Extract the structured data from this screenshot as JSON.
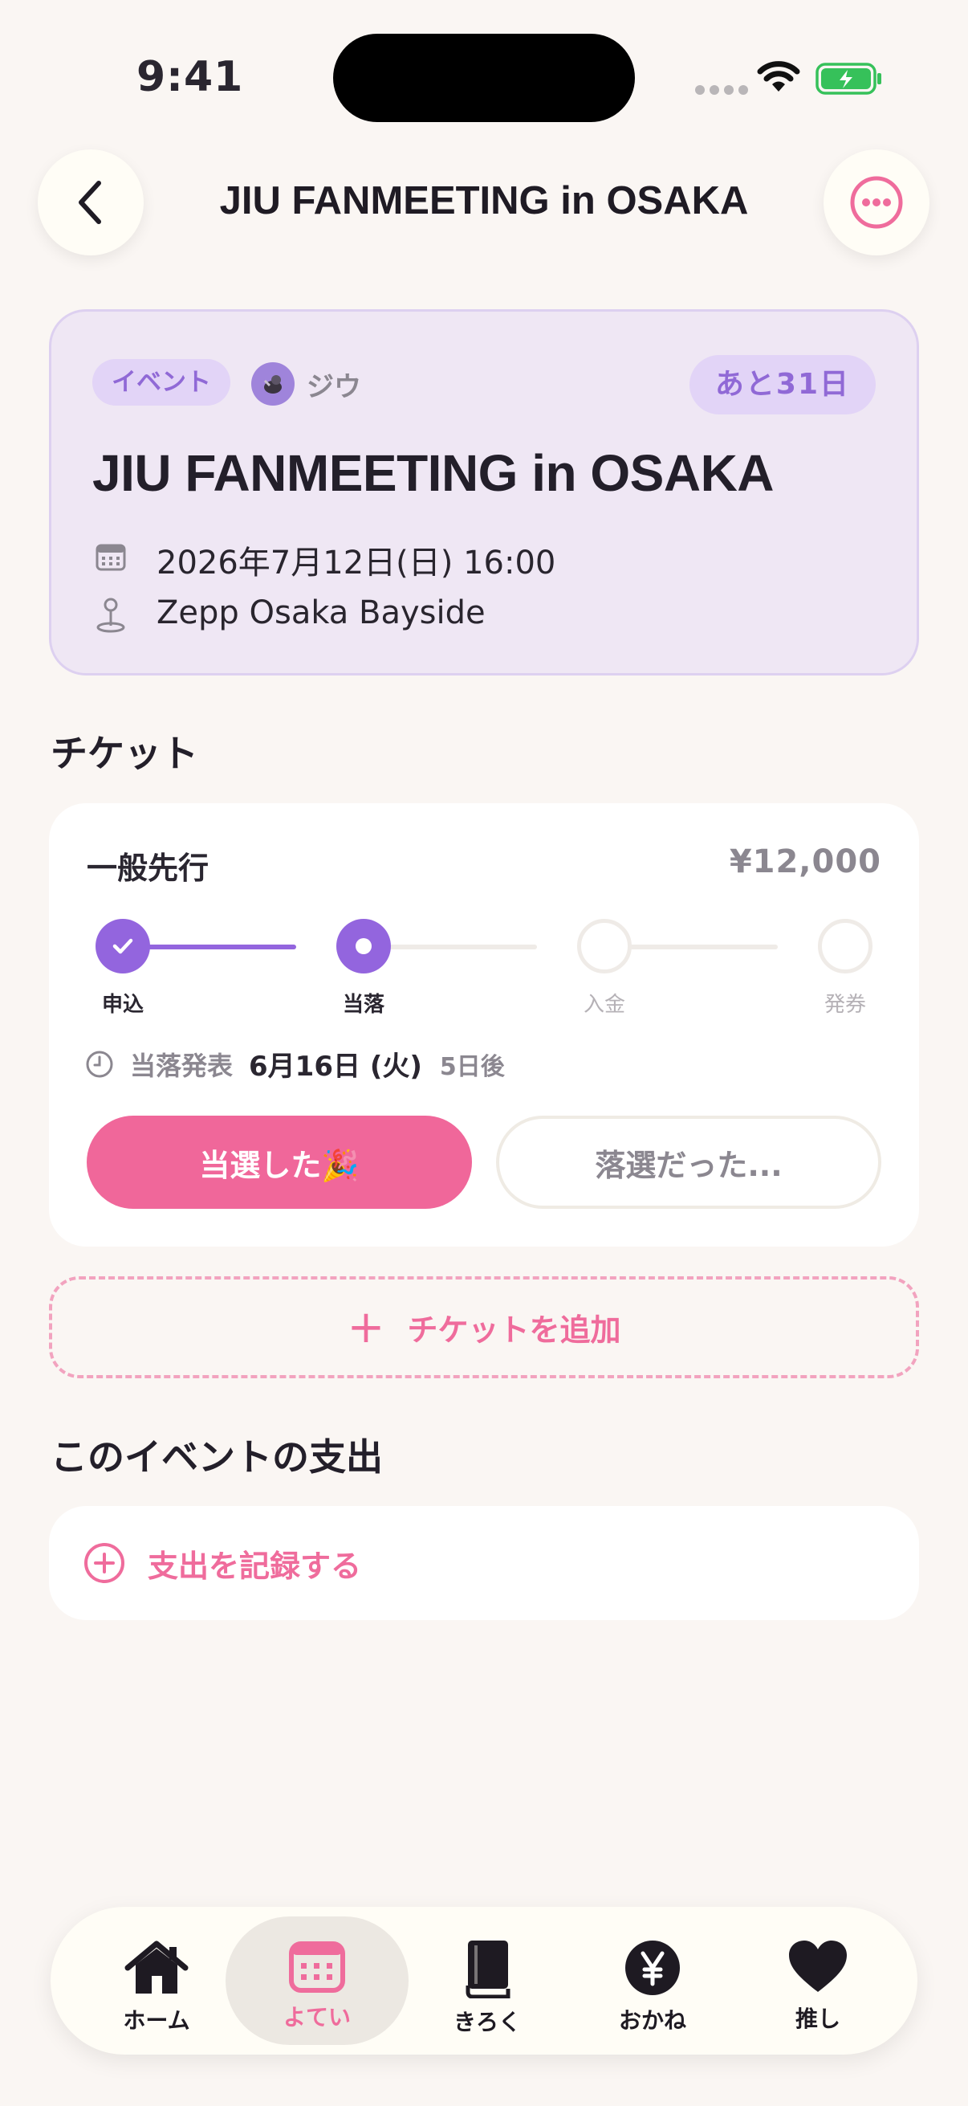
{
  "status_bar": {
    "time": "9:41"
  },
  "nav": {
    "title": "JIU FANMEETING in OSAKA"
  },
  "event": {
    "tag": "イベント",
    "artist": "ジウ",
    "countdown": "あと31日",
    "title": "JIU FANMEETING in OSAKA",
    "datetime": "2026年7月12日(日) 16:00",
    "venue": "Zepp Osaka Bayside"
  },
  "tickets_section": {
    "title": "チケット"
  },
  "ticket": {
    "type": "一般先行",
    "price": "¥12,000",
    "steps": [
      {
        "label": "申込",
        "state": "done"
      },
      {
        "label": "当落",
        "state": "current"
      },
      {
        "label": "入金",
        "state": "todo"
      },
      {
        "label": "発券",
        "state": "todo"
      }
    ],
    "announcement": {
      "label": "当落発表",
      "date": "6月16日 (火)",
      "relative": "5日後"
    },
    "win_button": "当選した🎉",
    "lose_button": "落選だった..."
  },
  "add_ticket": {
    "label": "チケットを追加"
  },
  "expense_section": {
    "title": "このイベントの支出"
  },
  "expense": {
    "record_label": "支出を記録する"
  },
  "tabbar": {
    "items": [
      {
        "label": "ホーム",
        "icon": "home-icon"
      },
      {
        "label": "よてい",
        "icon": "calendar-icon",
        "active": true
      },
      {
        "label": "きろく",
        "icon": "book-icon"
      },
      {
        "label": "おかね",
        "icon": "yen-icon"
      },
      {
        "label": "推し",
        "icon": "heart-icon"
      }
    ]
  },
  "colors": {
    "accent_pink": "#F0679A",
    "accent_purple": "#9365DE",
    "background": "#FAF6F3",
    "event_card_bg": "#EFE7F4"
  }
}
